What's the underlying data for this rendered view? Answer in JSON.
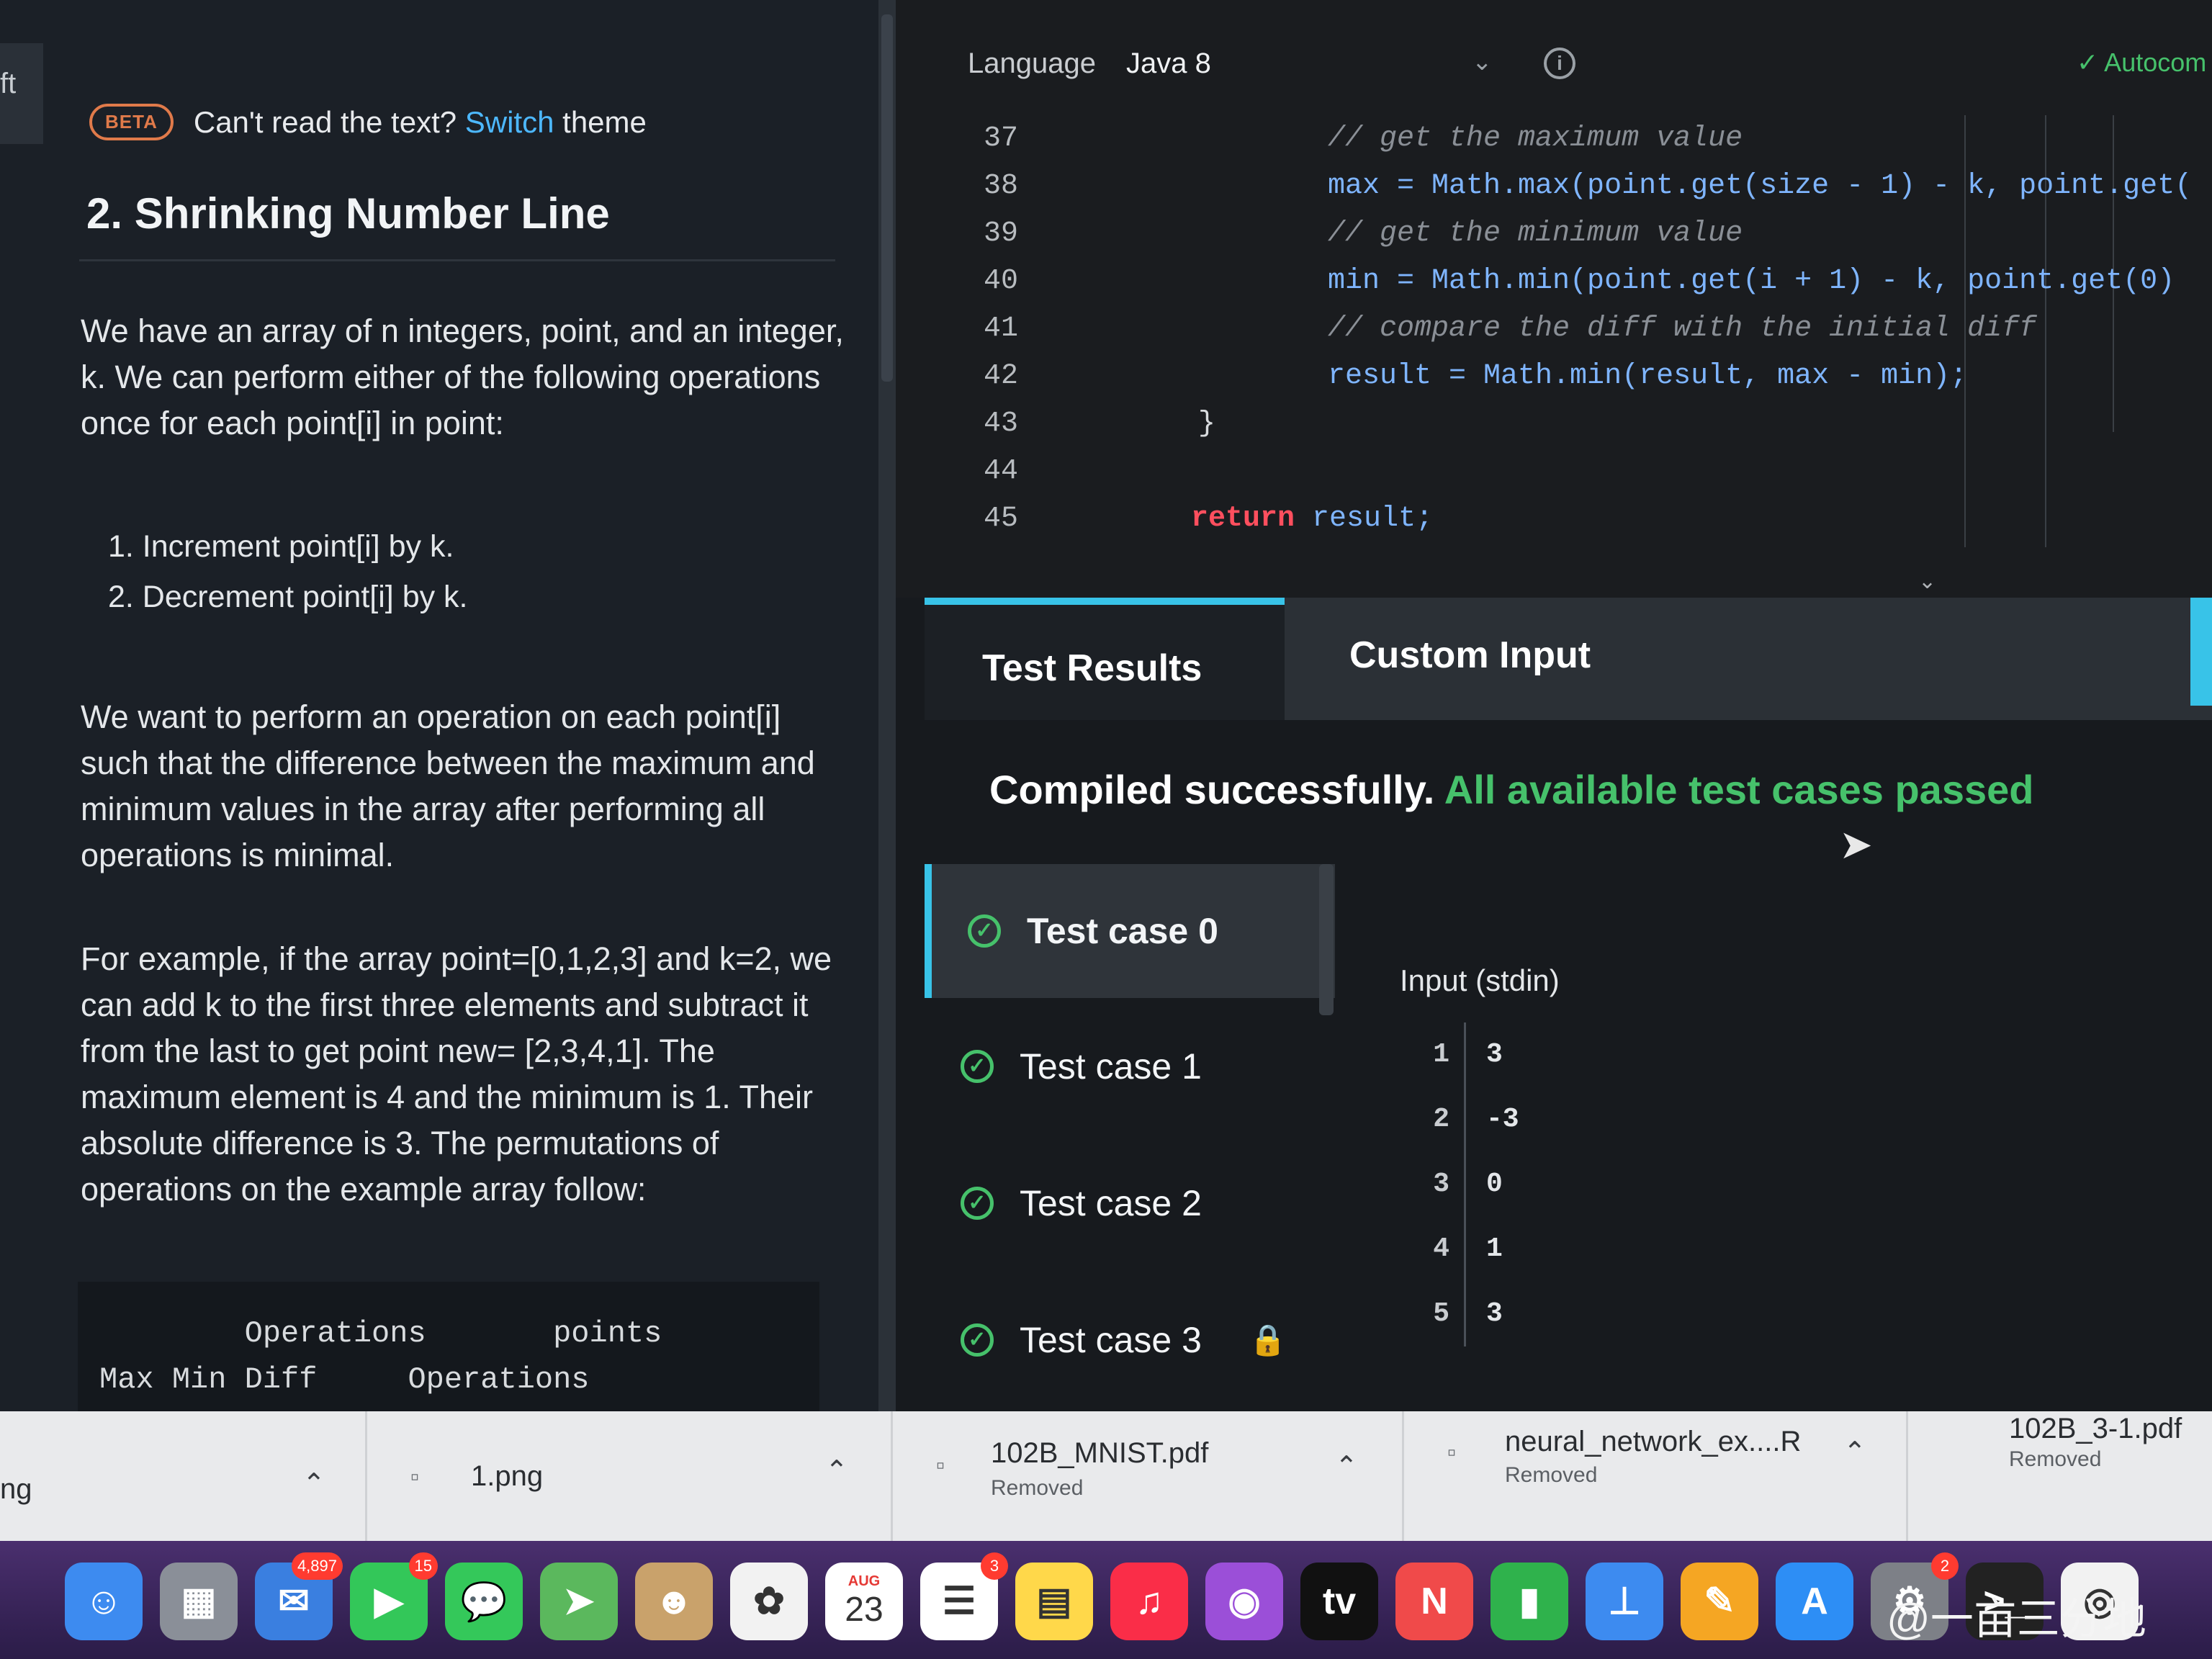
{
  "left_edge_text": "ft",
  "beta": {
    "badge": "BETA",
    "prompt": "Can't read the text?",
    "link": "Switch",
    "suffix": "theme"
  },
  "problem": {
    "title": "2. Shrinking Number Line",
    "p1": "We have an array of n integers, point, and an integer, k. We can perform either of the following operations once for each point[i] in point:",
    "ops": [
      "1. Increment point[i] by k.",
      "2. Decrement point[i] by k."
    ],
    "p2": "We want to perform an operation on each point[i] such that the difference between the maximum and minimum values in the array after performing all operations is minimal.",
    "p3": "For example, if the array point=[0,1,2,3] and k=2, we can add k to the first three elements and subtract it from the last to get point new= [2,3,4,1]. The maximum element is 4 and the minimum is 1. Their absolute difference is 3. The permutations of operations on the example array follow:",
    "table_head_1": "        Operations       points",
    "table_head_2": "Max Min Diff     Operations"
  },
  "editor": {
    "language_label": "Language",
    "language_value": "Java 8",
    "info_icon": "info-icon",
    "autocomplete": "✓ Autocom",
    "lines": [
      {
        "num": "37",
        "text": "// get the maximum value",
        "kind": "comment"
      },
      {
        "num": "38",
        "text": "max = Math.max(point.get(size - 1) - k, point.get(",
        "kind": "code"
      },
      {
        "num": "39",
        "text": "// get the minimum value",
        "kind": "comment"
      },
      {
        "num": "40",
        "text": "min = Math.min(point.get(i + 1) - k, point.get(0)",
        "kind": "code"
      },
      {
        "num": "41",
        "text": "// compare the diff with the initial diff",
        "kind": "comment"
      },
      {
        "num": "42",
        "text": "result = Math.min(result, max - min);",
        "kind": "code"
      },
      {
        "num": "43",
        "text": "}",
        "kind": "brace"
      },
      {
        "num": "44",
        "text": "",
        "kind": "code"
      },
      {
        "num": "45",
        "text": "result;",
        "kind": "return",
        "keyword": "return"
      }
    ]
  },
  "tabs": {
    "results": "Test Results",
    "custom": "Custom Input"
  },
  "status": {
    "compiled": "Compiled successfully.",
    "passed": "All available test cases passed"
  },
  "cases": [
    "Test case 0",
    "Test case 1",
    "Test case 2",
    "Test case 3"
  ],
  "stdin": {
    "label": "Input (stdin)",
    "rows": [
      [
        "1",
        "3"
      ],
      [
        "2",
        "-3"
      ],
      [
        "3",
        "0"
      ],
      [
        "4",
        "1"
      ],
      [
        "5",
        "3"
      ]
    ]
  },
  "downloads": [
    {
      "name": "ng",
      "sub": ""
    },
    {
      "name": "1.png",
      "sub": ""
    },
    {
      "name": "102B_MNIST.pdf",
      "sub": "Removed"
    },
    {
      "name": "neural_network_ex....R",
      "sub": "Removed"
    },
    {
      "name": "102B_3-1.pdf",
      "sub": "Removed"
    }
  ],
  "dock": {
    "apps": [
      {
        "name": "finder",
        "color": "#3d8bf0",
        "glyph": "☺",
        "badge": ""
      },
      {
        "name": "launchpad",
        "color": "#8a8f98",
        "glyph": "▦",
        "badge": ""
      },
      {
        "name": "mail",
        "color": "#3a7fe0",
        "glyph": "✉",
        "badge": "4,897"
      },
      {
        "name": "facetime",
        "color": "#33c759",
        "glyph": "▶",
        "badge": "15"
      },
      {
        "name": "messages",
        "color": "#34c85a",
        "glyph": "💬",
        "badge": ""
      },
      {
        "name": "maps",
        "color": "#5bb85d",
        "glyph": "➤",
        "badge": ""
      },
      {
        "name": "contacts",
        "color": "#c9a26b",
        "glyph": "☻",
        "badge": ""
      },
      {
        "name": "photos",
        "color": "#f2f2f2",
        "glyph": "✿",
        "badge": ""
      },
      {
        "name": "calendar",
        "color": "#ffffff",
        "glyph": "23",
        "badge": ""
      },
      {
        "name": "reminders",
        "color": "#ffffff",
        "glyph": "☰",
        "badge": "3"
      },
      {
        "name": "notes",
        "color": "#ffd84a",
        "glyph": "▤",
        "badge": ""
      },
      {
        "name": "music",
        "color": "#fa2d48",
        "glyph": "♫",
        "badge": ""
      },
      {
        "name": "podcasts",
        "color": "#9b4fd8",
        "glyph": "◉",
        "badge": ""
      },
      {
        "name": "tv",
        "color": "#111111",
        "glyph": "tv",
        "badge": ""
      },
      {
        "name": "news",
        "color": "#f04a4a",
        "glyph": "N",
        "badge": ""
      },
      {
        "name": "numbers",
        "color": "#2fb24c",
        "glyph": "▮",
        "badge": ""
      },
      {
        "name": "keynote",
        "color": "#3d8bf0",
        "glyph": "⊥",
        "badge": ""
      },
      {
        "name": "pages",
        "color": "#f5a623",
        "glyph": "✎",
        "badge": ""
      },
      {
        "name": "app-store",
        "color": "#2d8ef5",
        "glyph": "A",
        "badge": ""
      },
      {
        "name": "system-preferences",
        "color": "#7d8087",
        "glyph": "⚙",
        "badge": "2"
      },
      {
        "name": "terminal",
        "color": "#222222",
        "glyph": ">_",
        "badge": ""
      },
      {
        "name": "chrome",
        "color": "#f2f2f2",
        "glyph": "◎",
        "badge": ""
      }
    ],
    "calendar_month": "AUG"
  },
  "watermark": "@一亩三分地"
}
